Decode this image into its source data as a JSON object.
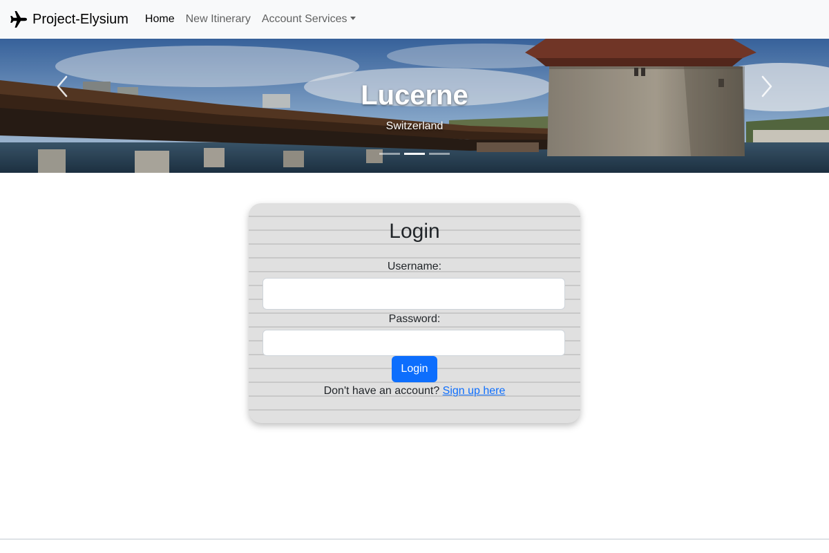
{
  "navbar": {
    "brand": "Project-Elysium",
    "brand_icon": "airplane-icon",
    "links": [
      {
        "label": "Home",
        "active": true
      },
      {
        "label": "New Itinerary",
        "active": false
      },
      {
        "label": "Account Services",
        "active": false,
        "dropdown": true
      }
    ]
  },
  "carousel": {
    "title": "Lucerne",
    "subtitle": "Switzerland",
    "slide_count": 3,
    "active_slide": 2,
    "prev_icon": "chevron-left-icon",
    "next_icon": "chevron-right-icon"
  },
  "login": {
    "title": "Login",
    "username_label": "Username:",
    "username_value": "",
    "password_label": "Password:",
    "password_value": "",
    "submit_label": "Login",
    "signup_prompt": "Don't have an account?",
    "signup_link": "Sign up here"
  },
  "colors": {
    "primary": "#0d6efd",
    "navbar_bg": "#f8f9fa",
    "card_bg": "#e0e0e0"
  }
}
